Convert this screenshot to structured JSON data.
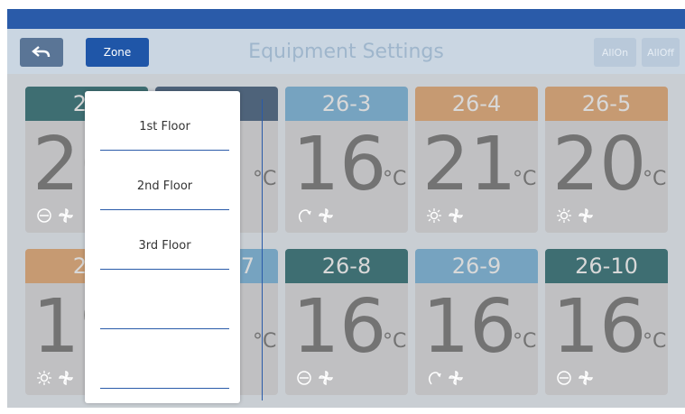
{
  "header": {
    "title": "Equipment Settings",
    "zone_label": "Zone",
    "allon_label": "AllOn",
    "alloff_label": "AllOff"
  },
  "cards": [
    {
      "id": "26-1",
      "name": "26",
      "temp": "26",
      "unit": "°C",
      "color": "teal",
      "mode": "dry-icon"
    },
    {
      "id": "26-2",
      "name": "",
      "temp": "",
      "unit": "°C",
      "color": "navy",
      "mode": ""
    },
    {
      "id": "26-3",
      "name": "26-3",
      "temp": "16",
      "unit": "°C",
      "color": "blue",
      "mode": "fan-mode-icon"
    },
    {
      "id": "26-4",
      "name": "26-4",
      "temp": "21",
      "unit": "°C",
      "color": "orange",
      "mode": "sun-icon"
    },
    {
      "id": "26-5",
      "name": "26-5",
      "temp": "20",
      "unit": "°C",
      "color": "orange",
      "mode": "sun-icon"
    },
    {
      "id": "26-6",
      "name": "26",
      "temp": "19",
      "unit": "°C",
      "color": "orange",
      "mode": "sun-icon"
    },
    {
      "id": "26-7",
      "name": "7",
      "temp": "",
      "unit": "°C",
      "color": "blue",
      "mode": ""
    },
    {
      "id": "26-8",
      "name": "26-8",
      "temp": "16",
      "unit": "°C",
      "color": "teal",
      "mode": "dry-icon"
    },
    {
      "id": "26-9",
      "name": "26-9",
      "temp": "16",
      "unit": "°C",
      "color": "blue",
      "mode": "fan-mode-icon"
    },
    {
      "id": "26-10",
      "name": "26-10",
      "temp": "16",
      "unit": "°C",
      "color": "teal",
      "mode": "dry-icon"
    }
  ],
  "zone_dropdown": {
    "items": [
      "1st Floor",
      "2nd Floor",
      "3rd Floor",
      "",
      ""
    ]
  }
}
